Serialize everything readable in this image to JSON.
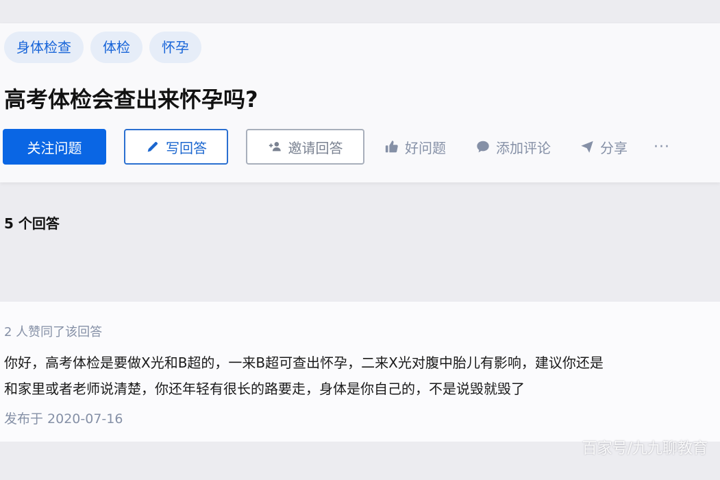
{
  "question": {
    "topics": [
      "身体检查",
      "体检",
      "怀孕"
    ],
    "title": "高考体检会查出来怀孕吗?",
    "actions": {
      "follow": "关注问题",
      "write": "写回答",
      "invite": "邀请回答",
      "good_question": "好问题",
      "add_comment": "添加评论",
      "share": "分享",
      "more": "···"
    }
  },
  "answers": {
    "header": "5 个回答",
    "first": {
      "vote_info": "2 人赞同了该回答",
      "content_lines": [
        "你好，高考体检是要做X光和B超的，一来B超可查出怀孕，二来X光对腹中胎儿有影响，建议你还是",
        "和家里或者老师说清楚，你还年轻有很长的路要走，身体是你自己的，不是说毁就毁了"
      ],
      "publish_time": "发布于 2020-07-16"
    }
  },
  "watermark": "百家号/九九聊教育",
  "colors": {
    "accent": "#0a66e4",
    "tag_bg": "#e6edf8",
    "muted": "#8590a6"
  },
  "icons": {
    "write": "pencil-icon",
    "invite": "add-person-icon",
    "good_question": "thumbs-up-icon",
    "comment": "speech-bubble-icon",
    "share": "paper-plane-icon"
  }
}
